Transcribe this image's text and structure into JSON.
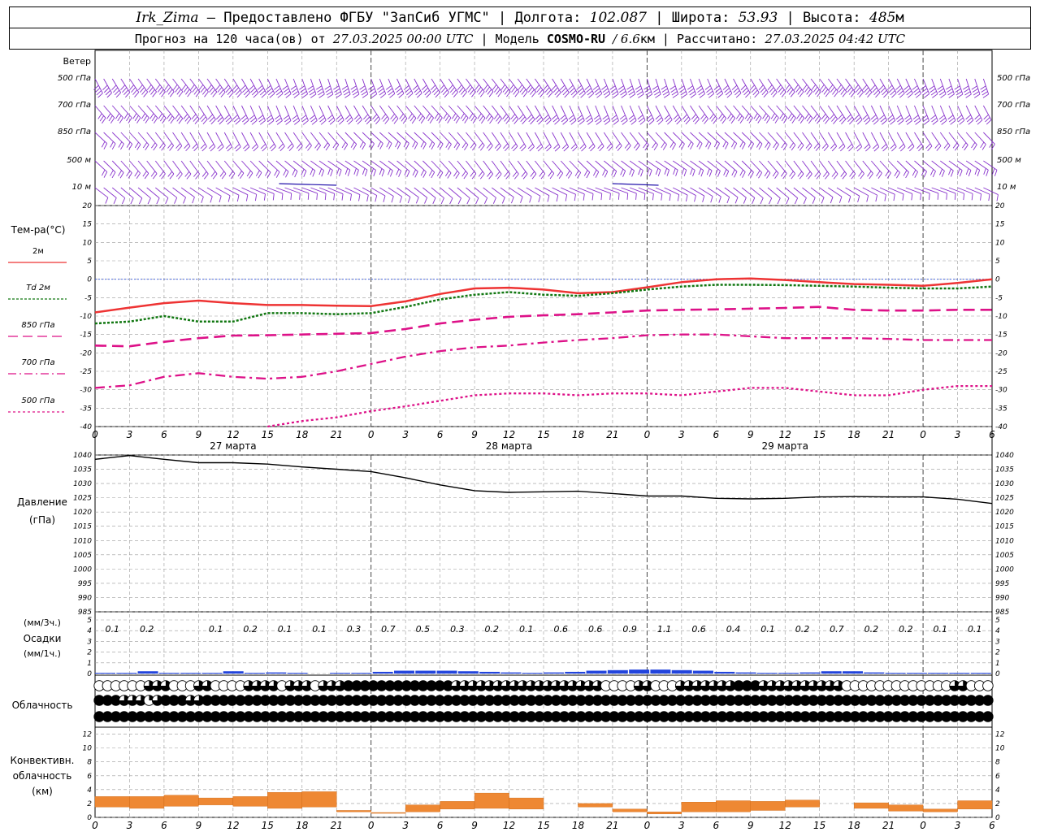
{
  "header": {
    "station": "Irk_Zima",
    "provided": "– Предоставлено ФГБУ \"ЗапСиб УГМС\" |",
    "lon_label": "Долгота:",
    "lon_value": "102.087",
    "lat_label": "| Широта:",
    "lat_value": "53.93",
    "alt_label": "| Высота:",
    "alt_value": "485",
    "alt_unit": "м",
    "forecast_label": "Прогноз на 120 часа(ов) от",
    "forecast_date": "27.03.2025 00:00 UTC",
    "model_label": "| Модель",
    "model_name": "COSMO-RU",
    "model_res": "/ 6.6",
    "model_res_unit": "км",
    "calc_label": "| Рассчитано:",
    "calc_date": "27.03.2025 04:42 UTC"
  },
  "wind_panel": {
    "title": "Ветер",
    "levels": [
      "500 гПа",
      "700 гПа",
      "850 гПа",
      "500 м",
      "10 м"
    ]
  },
  "temp_panel": {
    "title": "Тем-ра(°С)",
    "legend": [
      {
        "label": "2м",
        "color": "#ee3333",
        "dash": ""
      },
      {
        "label": "Td 2м",
        "color": "#117711",
        "dash": "3,2"
      },
      {
        "label": "850 гПа",
        "color": "#dd1188",
        "dash": "12,6"
      },
      {
        "label": "700 гПа",
        "color": "#dd1188",
        "dash": "10,4,2,4"
      },
      {
        "label": "500 гПа",
        "color": "#dd1188",
        "dash": "3,3"
      }
    ],
    "y_ticks": [
      "20",
      "15",
      "10",
      "5",
      "0",
      "-5",
      "-10",
      "-15",
      "-20",
      "-25",
      "-30",
      "-35",
      "-40"
    ]
  },
  "pressure_panel": {
    "title": "Давление",
    "unit": "(гПа)",
    "y_ticks": [
      "1040",
      "1035",
      "1030",
      "1025",
      "1020",
      "1015",
      "1010",
      "1005",
      "1000",
      "995",
      "990",
      "985"
    ]
  },
  "precip_panel": {
    "title": "Осадки",
    "unit3": "(мм/3ч.)",
    "unit1": "(мм/1ч.)",
    "y_ticks": [
      "5",
      "4",
      "3",
      "2",
      "1",
      "0"
    ],
    "totals_3h": [
      "0.1",
      "0.2",
      "",
      "0.1",
      "0.2",
      "0.1",
      "0.1",
      "0.3",
      "0.7",
      "0.5",
      "0.3",
      "0.2",
      "0.1",
      "0.6",
      "0.6",
      "0.9",
      "1.1",
      "0.6",
      "0.4",
      "0.1",
      "0.2",
      "0.7",
      "0.2",
      "0.2",
      "0.1",
      "0.1"
    ]
  },
  "cloud_panel": {
    "title": "Облачность"
  },
  "conv_panel": {
    "title_lines": [
      "Конвективн.",
      "облачность",
      "(км)"
    ],
    "y_ticks": [
      "12",
      "10",
      "8",
      "6",
      "4",
      "2",
      "0"
    ]
  },
  "x_axis": {
    "hour_labels": [
      "0",
      "3",
      "6",
      "9",
      "12",
      "15",
      "18",
      "21",
      "0",
      "3",
      "6",
      "9",
      "12",
      "15",
      "18",
      "21",
      "0",
      "3",
      "6",
      "9",
      "12",
      "15",
      "18",
      "21",
      "0",
      "3",
      "6"
    ],
    "day_labels": [
      "27 марта",
      "28 марта",
      "29 марта"
    ]
  },
  "colors": {
    "wind": "#8833cc",
    "wind_dark": "#2211aa",
    "t2m": "#ee3333",
    "td2m": "#117711",
    "upper": "#dd1188",
    "pressure": "#000000",
    "precip": "#2244dd",
    "conv": "#ee8833",
    "grid": "#999999"
  },
  "chart_data": {
    "type": "line",
    "x_hours": [
      0,
      3,
      6,
      9,
      12,
      15,
      18,
      21,
      24,
      27,
      30,
      33,
      36,
      39,
      42,
      45,
      48,
      51,
      54,
      57,
      60,
      63,
      66,
      69,
      72,
      75,
      78
    ],
    "series": [
      {
        "name": "2м",
        "values": [
          -9,
          -7.7,
          -6.5,
          -5.8,
          -6.5,
          -7,
          -7,
          -7.2,
          -7.3,
          -6,
          -4,
          -2.5,
          -2.3,
          -2.8,
          -3.8,
          -3.5,
          -2.2,
          -0.8,
          0,
          0.2,
          -0.2,
          -0.8,
          -1.3,
          -1.5,
          -1.8,
          -1,
          0
        ]
      },
      {
        "name": "Td 2м",
        "values": [
          -12,
          -11.5,
          -10,
          -11.5,
          -11.5,
          -9.2,
          -9.2,
          -9.5,
          -9.2,
          -7.5,
          -5.5,
          -4.2,
          -3.5,
          -4.2,
          -4.5,
          -3.8,
          -2.8,
          -2,
          -1.5,
          -1.5,
          -1.6,
          -1.8,
          -2,
          -2.3,
          -2.5,
          -2.5,
          -2
        ]
      },
      {
        "name": "850 гПа",
        "values": [
          -18,
          -18.2,
          -17,
          -16,
          -15.3,
          -15.2,
          -15,
          -14.8,
          -14.6,
          -13.5,
          -12,
          -11,
          -10.2,
          -9.8,
          -9.5,
          -9,
          -8.5,
          -8.3,
          -8.2,
          -8,
          -7.8,
          -7.5,
          -8.3,
          -8.5,
          -8.5,
          -8.3,
          -8.3
        ]
      },
      {
        "name": "700 гПа",
        "values": [
          -29.5,
          -28.8,
          -26.5,
          -25.5,
          -26.5,
          -27,
          -26.5,
          -25,
          -23,
          -21,
          -19.5,
          -18.5,
          -18,
          -17.2,
          -16.5,
          -16,
          -15.2,
          -15,
          -15,
          -15.5,
          -16,
          -16,
          -16,
          -16.2,
          -16.5,
          -16.5,
          -16.5
        ]
      },
      {
        "name": "500 гПа",
        "values": [
          null,
          null,
          null,
          null,
          null,
          -40.5,
          -38.5,
          -37.5,
          -35.8,
          -34.5,
          -33,
          -31.5,
          -31,
          -31,
          -31.5,
          -31,
          -31,
          -31.5,
          -30.5,
          -29.5,
          -29.5,
          -30.5,
          -31.5,
          -31.5,
          -30,
          -29,
          -29
        ]
      },
      {
        "name": "Давление",
        "values": [
          1038.5,
          1039.8,
          1038.5,
          1037.3,
          1037.3,
          1036.8,
          1035.8,
          1035,
          1034.2,
          1032,
          1029.5,
          1027.5,
          1026.9,
          1027.1,
          1027.3,
          1026.5,
          1025.6,
          1025.6,
          1024.8,
          1024.6,
          1024.8,
          1025.3,
          1025.4,
          1025.3,
          1025.3,
          1024.5,
          1023
        ]
      }
    ],
    "precip_1h_mm": [
      0.02,
      0.05,
      0.2,
      0.05,
      0.02,
      0.05,
      0.2,
      0.05,
      0.1,
      0.05,
      0,
      0.05,
      0.05,
      0.15,
      0.25,
      0.25,
      0.25,
      0.2,
      0.15,
      0.1,
      0.05,
      0.1,
      0.15,
      0.25,
      0.3,
      0.35,
      0.35,
      0.3,
      0.25,
      0.15,
      0.1,
      0.05,
      0.05,
      0.1,
      0.2,
      0.2,
      0.1,
      0.05,
      0.05,
      0.05,
      0.05,
      0.05
    ],
    "cloud_low": [
      1,
      1,
      1,
      1,
      1,
      1,
      3,
      3,
      3,
      1,
      1,
      1,
      3,
      3,
      1,
      1,
      1,
      1,
      3,
      3,
      3,
      3,
      1,
      3,
      3,
      3,
      1,
      3,
      3,
      3,
      4,
      4,
      4,
      4,
      4,
      4,
      4,
      4,
      4,
      4,
      4,
      4,
      4,
      3,
      3,
      3,
      3,
      3,
      3,
      3,
      3,
      3,
      3,
      3,
      3,
      3,
      3,
      3,
      3,
      3,
      3,
      1,
      1,
      1,
      1,
      3,
      3,
      1,
      1,
      1,
      3,
      3,
      3,
      3,
      3,
      3,
      3,
      4,
      4,
      4,
      3,
      3,
      3,
      3,
      3,
      3,
      3,
      3,
      3,
      3,
      1,
      1,
      1,
      1,
      1,
      1,
      1,
      1,
      1,
      1,
      1,
      1,
      1,
      3,
      3,
      1,
      1,
      1
    ],
    "cloud_mid": [
      4,
      4,
      4,
      3,
      3,
      3,
      2,
      3,
      4,
      4,
      4,
      3,
      3,
      4,
      4,
      4,
      4,
      4,
      4,
      4,
      4,
      4,
      4,
      4,
      4,
      4,
      4,
      4,
      4,
      4,
      4,
      4,
      4,
      4,
      4,
      4,
      4,
      4,
      4,
      4,
      4,
      4,
      4,
      4,
      4,
      4,
      4,
      4,
      4,
      4,
      4,
      4,
      4,
      4,
      4,
      4,
      4,
      4,
      4,
      4,
      4,
      4,
      4,
      4,
      4,
      4,
      4,
      4,
      4,
      4,
      4,
      4,
      4,
      4,
      4,
      4,
      4,
      4,
      4,
      4,
      4,
      4,
      4,
      4,
      4,
      4,
      4,
      4,
      4,
      4,
      4,
      4,
      4,
      4,
      4,
      4,
      4,
      4,
      4,
      4,
      4,
      4,
      4,
      4,
      4,
      4,
      4,
      4
    ],
    "cloud_high": [
      4,
      4,
      4,
      4,
      4,
      4,
      4,
      4,
      4,
      4,
      4,
      4,
      4,
      4,
      4,
      4,
      4,
      4,
      4,
      4,
      4,
      4,
      4,
      4,
      4,
      4,
      4,
      4,
      4,
      4,
      4,
      4,
      4,
      4,
      4,
      4,
      4,
      4,
      4,
      4,
      4,
      4,
      4,
      4,
      4,
      4,
      4,
      4,
      4,
      4,
      4,
      4,
      4,
      4,
      4,
      4,
      4,
      4,
      4,
      4,
      4,
      4,
      4,
      4,
      4,
      4,
      4,
      4,
      4,
      4,
      4,
      4,
      4,
      4,
      4,
      4,
      4,
      4,
      4,
      4,
      4,
      4,
      4,
      4,
      4,
      4,
      4,
      4,
      4,
      4,
      4,
      4,
      4,
      4,
      4,
      4,
      4,
      4,
      4,
      4,
      4,
      4,
      4,
      4,
      4,
      4,
      4,
      4
    ],
    "conv_base_km": [
      1.5,
      1.3,
      1.6,
      1.8,
      1.6,
      1.3,
      1.5,
      0.8,
      0.6,
      0.8,
      1.2,
      1.3,
      1.2,
      0,
      1.5,
      0.8,
      0.5,
      0.8,
      0.8,
      1.0,
      1.5,
      0,
      1.3,
      0.9,
      0.8,
      1.2,
      1.3
    ],
    "conv_top_km": [
      3.0,
      3.0,
      3.2,
      2.8,
      3.0,
      3.6,
      3.7,
      1.0,
      0.7,
      1.8,
      2.3,
      3.5,
      2.8,
      0,
      2.0,
      1.2,
      0.8,
      2.2,
      2.4,
      2.3,
      2.5,
      0,
      2.1,
      1.8,
      1.2,
      2.4,
      2.5
    ],
    "ylim_temp": [
      -40,
      20
    ],
    "ylim_pressure": [
      985,
      1040
    ],
    "ylim_precip": [
      0,
      5
    ],
    "ylim_conv": [
      0,
      13
    ]
  }
}
